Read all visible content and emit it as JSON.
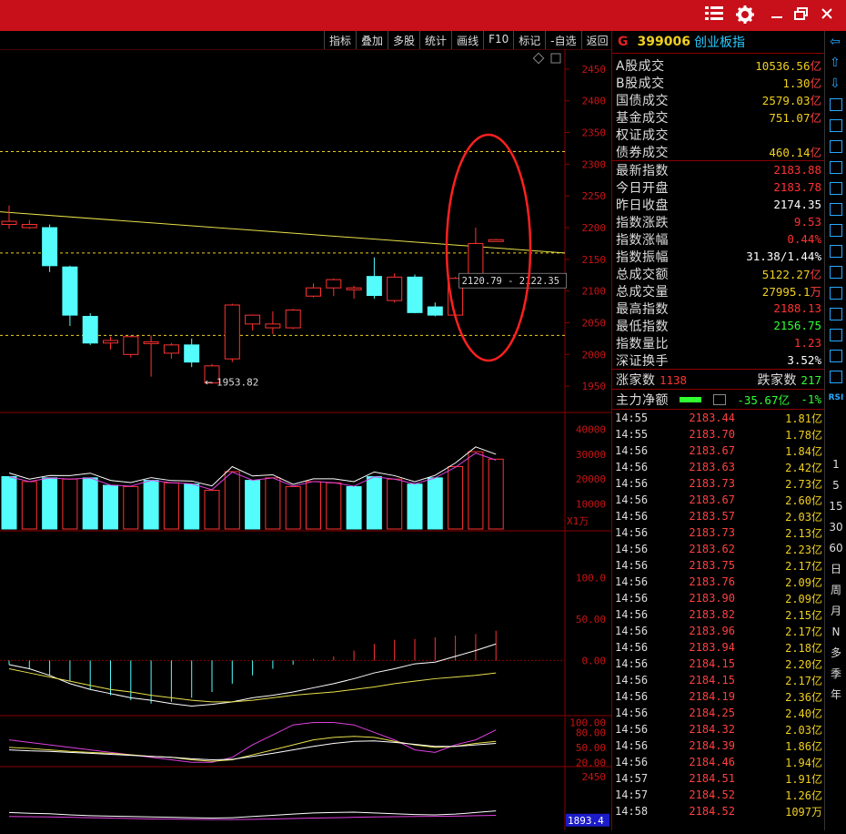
{
  "window": {
    "title_icons": [
      "menu-list-icon",
      "settings-gear-icon",
      "minimize-icon",
      "restore-icon",
      "close-icon"
    ]
  },
  "toolbar": {
    "items": [
      "指标",
      "叠加",
      "多股",
      "统计",
      "画线",
      "F10",
      "标记",
      "-自选",
      "返回"
    ]
  },
  "colors": {
    "up": "#ff3232",
    "down": "#54fcfc",
    "titlebar": "#c8101a",
    "axis": "#c81414",
    "yellow": "#f0d020",
    "ma_white": "#ffffff",
    "ma_yellow": "#e8e04a",
    "ma_purple": "#e040e0"
  },
  "chart_data": [
    {
      "type": "candlestick",
      "ylim": [
        1920,
        2470
      ],
      "y_ticks": [
        "2450",
        "2400",
        "2350",
        "2300",
        "2250",
        "2200",
        "2150",
        "2100",
        "2050",
        "2000",
        "1950"
      ],
      "ohlc": [
        [
          2205,
          2235,
          2198,
          2210
        ],
        [
          2200,
          2212,
          2198,
          2205
        ],
        [
          2200,
          2205,
          2130,
          2140
        ],
        [
          2138,
          2140,
          2045,
          2062
        ],
        [
          2060,
          2065,
          2015,
          2018
        ],
        [
          2018,
          2028,
          2008,
          2022
        ],
        [
          2000,
          2030,
          1995,
          2028
        ],
        [
          2020,
          2030,
          1965,
          2020
        ],
        [
          2002,
          2018,
          1993,
          2015
        ],
        [
          2015,
          2025,
          1980,
          1988
        ],
        [
          1955,
          1985,
          1953.82,
          1982
        ],
        [
          1993,
          2080,
          1988,
          2078
        ],
        [
          2048,
          2063,
          2038,
          2062
        ],
        [
          2042,
          2068,
          2032,
          2048
        ],
        [
          2042,
          2072,
          2040,
          2070
        ],
        [
          2092,
          2112,
          2090,
          2105
        ],
        [
          2105,
          2120,
          2092,
          2118
        ],
        [
          2102,
          2108,
          2088,
          2105
        ],
        [
          2123,
          2153,
          2088,
          2093
        ],
        [
          2085,
          2128,
          2082,
          2122
        ],
        [
          2122,
          2126,
          2065,
          2066
        ],
        [
          2075,
          2082,
          2060,
          2062
        ],
        [
          2062,
          2122,
          2058,
          2120
        ],
        [
          2127,
          2200,
          2115,
          2175
        ],
        [
          2180,
          2182,
          2178,
          2181
        ]
      ],
      "ma_line": [
        2225,
        2160
      ],
      "dashed_levels": [
        2320,
        2160,
        2030
      ],
      "low_label": "1953.82",
      "range_label": "2120.79 - 2122.35"
    },
    {
      "type": "bar",
      "ylim": [
        0,
        46000
      ],
      "y_ticks": [
        "40000",
        "30000",
        "20000",
        "10000"
      ],
      "unit_label": "X1万",
      "values": [
        21000,
        19000,
        20500,
        20000,
        20500,
        17500,
        17000,
        19500,
        18500,
        18000,
        15500,
        23000,
        19500,
        20500,
        17000,
        19000,
        18500,
        17000,
        21000,
        20000,
        18000,
        20500,
        25000,
        31000,
        28000
      ],
      "up": [
        false,
        true,
        false,
        true,
        false,
        false,
        true,
        false,
        true,
        false,
        true,
        true,
        false,
        true,
        true,
        true,
        true,
        false,
        false,
        true,
        false,
        false,
        true,
        true,
        true
      ]
    },
    {
      "type": "bar",
      "ylim": [
        -60,
        150
      ],
      "y_ticks": [
        "100.0",
        "50.00",
        "0.00"
      ],
      "values": [
        -5,
        -10,
        -18,
        -25,
        -35,
        -42,
        -48,
        -52,
        -50,
        -45,
        -38,
        -28,
        -18,
        -10,
        -5,
        2,
        5,
        12,
        20,
        25,
        26,
        28,
        30,
        32,
        36
      ],
      "lines": [
        [
          -5,
          -10,
          -18,
          -28,
          -35,
          -40,
          -45,
          -48,
          -52,
          -55,
          -53,
          -50,
          -45,
          -42,
          -38,
          -33,
          -28,
          -22,
          -15,
          -10,
          -4,
          -2,
          5,
          12,
          20
        ],
        [
          -10,
          -15,
          -20,
          -25,
          -30,
          -35,
          -38,
          -42,
          -45,
          -48,
          -50,
          -50,
          -48,
          -45,
          -42,
          -40,
          -38,
          -35,
          -32,
          -28,
          -25,
          -22,
          -20,
          -18,
          -15
        ]
      ]
    },
    {
      "type": "line",
      "ylim": [
        15,
        110
      ],
      "y_ticks": [
        "100.00",
        "80.00",
        "50.00",
        "20.00"
      ],
      "series": [
        [
          65,
          60,
          55,
          50,
          45,
          40,
          35,
          30,
          25,
          20,
          20,
          30,
          55,
          75,
          95,
          100,
          100,
          95,
          80,
          65,
          45,
          40,
          55,
          65,
          85
        ],
        [
          50,
          48,
          45,
          42,
          40,
          38,
          35,
          32,
          30,
          25,
          22,
          25,
          35,
          45,
          55,
          65,
          70,
          72,
          70,
          62,
          55,
          50,
          52,
          58,
          62
        ],
        [
          45,
          43,
          42,
          40,
          38,
          36,
          34,
          32,
          30,
          27,
          25,
          26,
          32,
          38,
          45,
          52,
          58,
          62,
          63,
          60,
          56,
          52,
          52,
          55,
          58
        ]
      ]
    },
    {
      "type": "line",
      "ylim": [
        1800,
        2550
      ],
      "y_ticks": [
        "2450"
      ],
      "current_label": "1893.4",
      "series": [
        [
          2000,
          1990,
          1985,
          1970,
          1960,
          1955,
          1950,
          1945,
          1940,
          1935,
          1930,
          1935,
          1950,
          1965,
          1980,
          1995,
          2000,
          2005,
          1995,
          1985,
          1975,
          1970,
          1980,
          2000,
          2020
        ],
        [
          1950,
          1948,
          1945,
          1940,
          1935,
          1930,
          1925,
          1920,
          1918,
          1915,
          1912,
          1912,
          1915,
          1920,
          1925,
          1930,
          1935,
          1940,
          1945,
          1948,
          1950,
          1952,
          1955,
          1960,
          1965
        ]
      ]
    }
  ],
  "quote": {
    "market_mark": "G",
    "code": "399006",
    "name": "创业板指",
    "turnover": [
      {
        "label": "A股成交",
        "value": "10536.56",
        "unit": "亿"
      },
      {
        "label": "B股成交",
        "value": "1.30",
        "unit": "亿"
      },
      {
        "label": "国债成交",
        "value": "2579.03",
        "unit": "亿"
      },
      {
        "label": "基金成交",
        "value": "751.07",
        "unit": "亿"
      },
      {
        "label": "权证成交",
        "value": "",
        "unit": ""
      },
      {
        "label": "债券成交",
        "value": "460.14",
        "unit": "亿"
      }
    ],
    "stats": [
      {
        "label": "最新指数",
        "value": "2183.88",
        "color": "#ff3232"
      },
      {
        "label": "今日开盘",
        "value": "2183.78",
        "color": "#ff3232"
      },
      {
        "label": "昨日收盘",
        "value": "2174.35",
        "color": "#ffffff"
      },
      {
        "label": "指数涨跌",
        "value": "9.53",
        "color": "#ff3232"
      },
      {
        "label": "指数涨幅",
        "value": "0.44%",
        "color": "#ff3232"
      },
      {
        "label": "指数振幅",
        "value": "31.38/1.44%",
        "color": "#ffffff"
      },
      {
        "label": "总成交额",
        "value": "5122.27",
        "unit": "亿",
        "color": "#f0d020"
      },
      {
        "label": "总成交量",
        "value": "27995.1",
        "unit": "万",
        "color": "#f0d020"
      },
      {
        "label": "最高指数",
        "value": "2188.13",
        "color": "#ff3232"
      },
      {
        "label": "最低指数",
        "value": "2156.75",
        "color": "#32ff32"
      },
      {
        "label": "指数量比",
        "value": "1.23",
        "color": "#ff3232"
      },
      {
        "label": "深证换手",
        "value": "3.52%",
        "color": "#ffffff"
      }
    ],
    "breadth": {
      "up_label": "涨家数",
      "up": "1138",
      "down_label": "跌家数",
      "down": "217"
    },
    "flow": {
      "label": "主力净额",
      "value": "-35.67亿",
      "pct": "-1%"
    }
  },
  "ticks": [
    {
      "time": "14:55",
      "price": "2183.44",
      "vol": "1.81亿"
    },
    {
      "time": "14:55",
      "price": "2183.70",
      "vol": "1.78亿"
    },
    {
      "time": "14:56",
      "price": "2183.67",
      "vol": "1.84亿"
    },
    {
      "time": "14:56",
      "price": "2183.63",
      "vol": "2.42亿"
    },
    {
      "time": "14:56",
      "price": "2183.73",
      "vol": "2.73亿"
    },
    {
      "time": "14:56",
      "price": "2183.67",
      "vol": "2.60亿"
    },
    {
      "time": "14:56",
      "price": "2183.57",
      "vol": "2.03亿"
    },
    {
      "time": "14:56",
      "price": "2183.73",
      "vol": "2.13亿"
    },
    {
      "time": "14:56",
      "price": "2183.62",
      "vol": "2.23亿"
    },
    {
      "time": "14:56",
      "price": "2183.75",
      "vol": "2.17亿"
    },
    {
      "time": "14:56",
      "price": "2183.76",
      "vol": "2.09亿"
    },
    {
      "time": "14:56",
      "price": "2183.90",
      "vol": "2.09亿"
    },
    {
      "time": "14:56",
      "price": "2183.82",
      "vol": "2.15亿"
    },
    {
      "time": "14:56",
      "price": "2183.96",
      "vol": "2.17亿"
    },
    {
      "time": "14:56",
      "price": "2183.94",
      "vol": "2.18亿"
    },
    {
      "time": "14:56",
      "price": "2184.15",
      "vol": "2.20亿"
    },
    {
      "time": "14:56",
      "price": "2184.15",
      "vol": "2.17亿"
    },
    {
      "time": "14:56",
      "price": "2184.19",
      "vol": "2.36亿"
    },
    {
      "time": "14:56",
      "price": "2184.25",
      "vol": "2.40亿"
    },
    {
      "time": "14:56",
      "price": "2184.32",
      "vol": "2.03亿"
    },
    {
      "time": "14:56",
      "price": "2184.39",
      "vol": "1.86亿"
    },
    {
      "time": "14:56",
      "price": "2184.46",
      "vol": "1.94亿"
    },
    {
      "time": "14:57",
      "price": "2184.51",
      "vol": "1.91亿"
    },
    {
      "time": "14:57",
      "price": "2184.52",
      "vol": "1.26亿"
    },
    {
      "time": "14:58",
      "price": "2184.52",
      "vol": "1097万"
    }
  ],
  "rail": {
    "icon_names": [
      "arrow-left-icon",
      "arrow-up-icon",
      "arrow-down-icon",
      "grid-icon",
      "table-icon",
      "chart-icon",
      "candle-icon",
      "f10-icon",
      "news-icon",
      "capital-icon",
      "window-icon",
      "f1-icon",
      "clock-icon",
      "rsi-icon",
      "money-icon",
      "pen-icon",
      "f5-icon",
      "sync-icon"
    ],
    "rsi_label": "RSI",
    "periods": [
      "1",
      "5",
      "15",
      "30",
      "60",
      "日",
      "周",
      "月",
      "N",
      "多",
      "季",
      "年"
    ]
  }
}
